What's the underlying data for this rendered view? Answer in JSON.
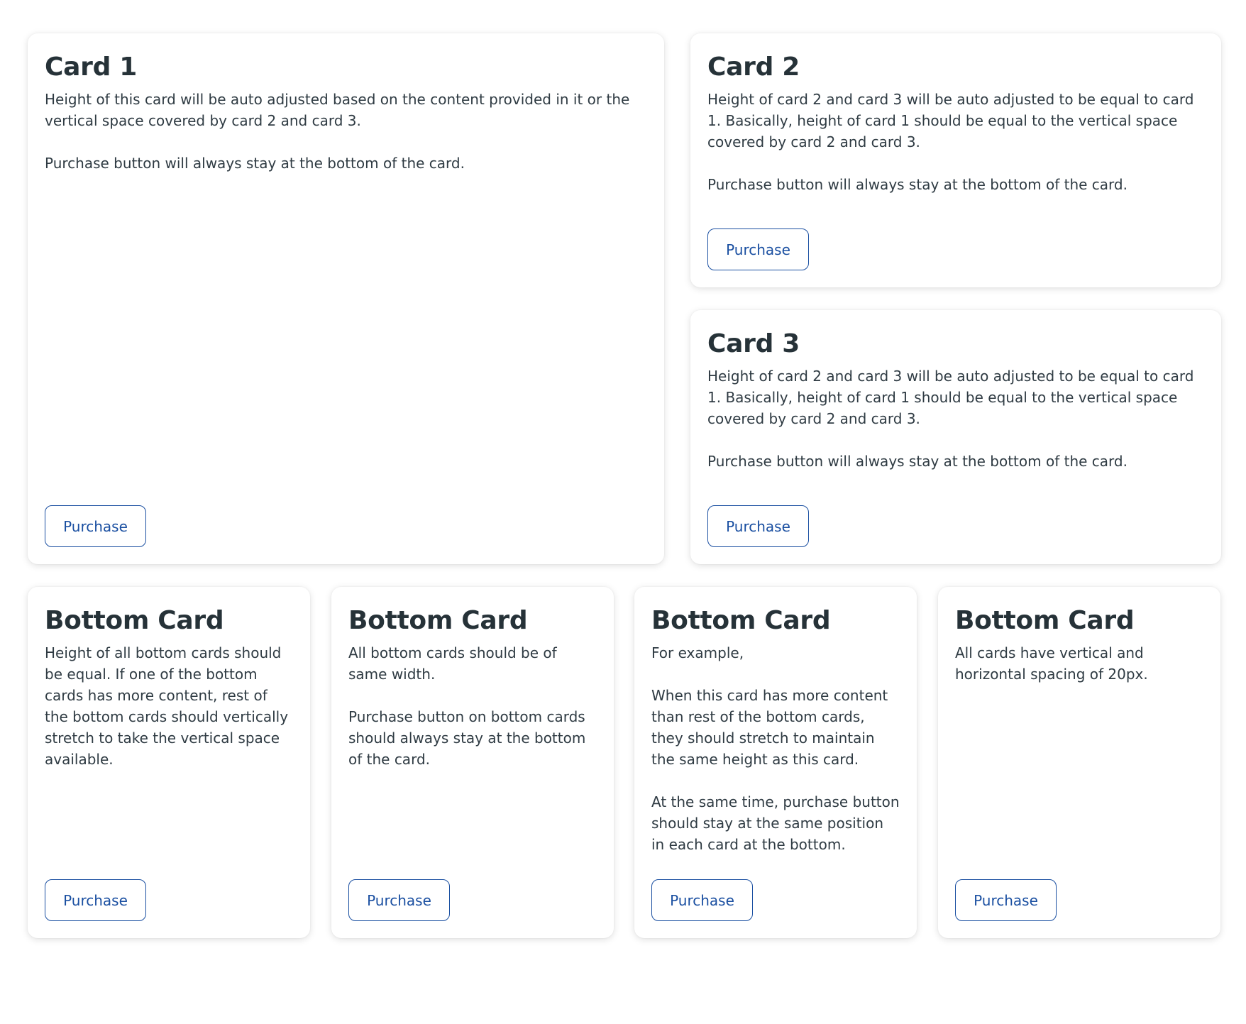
{
  "purchase_label": "Purchase",
  "colors": {
    "accent": "#1a4fa1",
    "text": "#263238",
    "background": "#ffffff"
  },
  "top_cards": [
    {
      "title": "Card 1",
      "paragraphs": [
        "Height of this card will be auto adjusted based on the content provided in it or the vertical space covered by card 2 and card 3.",
        "Purchase button will always stay at the bottom of the card."
      ]
    },
    {
      "title": "Card 2",
      "paragraphs": [
        "Height of card 2 and card 3 will be auto adjusted to be equal to card 1. Basically, height of card 1 should be equal to the vertical space covered by card 2 and card 3.",
        "Purchase button will always stay at the bottom of the card."
      ]
    },
    {
      "title": "Card 3",
      "paragraphs": [
        "Height of card 2 and card 3 will be auto adjusted to be equal to card 1. Basically, height of card 1 should be equal to the vertical space covered by card 2 and card 3.",
        "Purchase button will always stay at the bottom of the card."
      ]
    }
  ],
  "bottom_cards": [
    {
      "title": "Bottom Card",
      "paragraphs": [
        "Height of all bottom cards should be equal. If one of the bottom cards has more content, rest of the bottom cards should vertically stretch to take the vertical space available."
      ]
    },
    {
      "title": "Bottom Card",
      "paragraphs": [
        "All bottom cards should be of same width.",
        "Purchase button on bottom cards should always stay at the bottom of the card."
      ]
    },
    {
      "title": "Bottom Card",
      "paragraphs": [
        "For example,",
        "When this card has more content than rest of the bottom cards, they should stretch to maintain the same height as this card.",
        "At the same time, purchase button should stay at the same position in each card at the bottom."
      ]
    },
    {
      "title": "Bottom Card",
      "paragraphs": [
        "All cards have vertical and horizontal spacing of 20px."
      ]
    }
  ]
}
